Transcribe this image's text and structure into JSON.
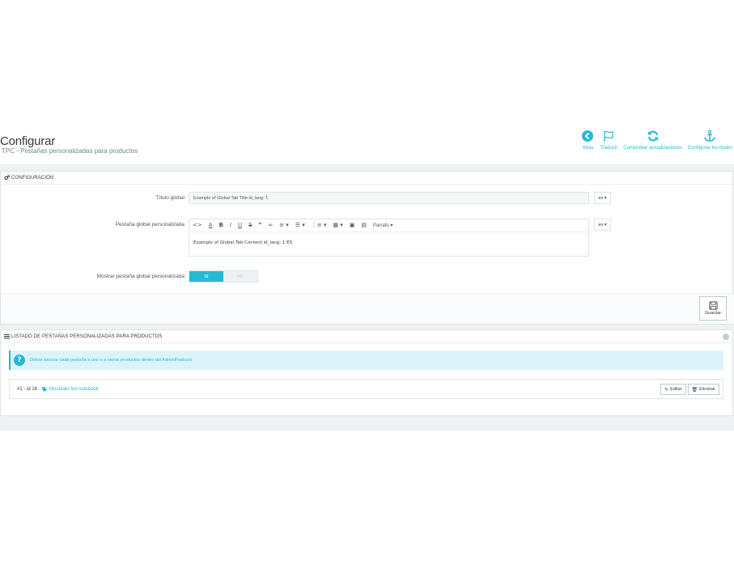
{
  "header": {
    "title": "Configurar",
    "subtitle": "TPC - Pestañas personalizadas para productos",
    "toolbar": [
      {
        "label": "Atras",
        "icon": "back-icon"
      },
      {
        "label": "Traducir",
        "icon": "flag-icon"
      },
      {
        "label": "Comprobar actualizaciones",
        "icon": "refresh-icon"
      },
      {
        "label": "Configurar los hooks",
        "icon": "anchor-icon"
      }
    ]
  },
  "config_panel": {
    "heading": "CONFIGURACIÓN",
    "global_title_label": "Título global",
    "global_title_value": "Example of Global Tab Title id_lang: 1",
    "lang": "es",
    "custom_tab_label": "Pestaña global personalizada",
    "editor": {
      "toolbar": [
        "<>",
        "A",
        "B",
        "I",
        "U",
        "S",
        "❞",
        "∞",
        "≡ ▾",
        "☰ ▾",
        "⋮≡ ▾",
        "▦ ▾",
        "▣",
        "▤"
      ],
      "format_select": "Parrafo",
      "content": "Example of Global Tab Content id_lang: 1 ES"
    },
    "show_tab_label": "Mostrar pestaña global personalizada",
    "switch_on": "SÍ",
    "switch_off": "NO",
    "save_label": "Guardar"
  },
  "list_panel": {
    "heading": "LISTADO DE PESTAÑAS PERSONALIZADAS PARA PRODUCTOS",
    "alert": "Debes asociar cada pestaña a uno o a varios productos dentro del AdminProducts",
    "rows": [
      {
        "id": "#1 - id 16",
        "product": "Mountain fox notebook"
      }
    ],
    "edit_label": "Editar",
    "delete_label": "Eliminar"
  },
  "colors": {
    "accent": "#25b9d7",
    "background": "#eff1f2"
  }
}
